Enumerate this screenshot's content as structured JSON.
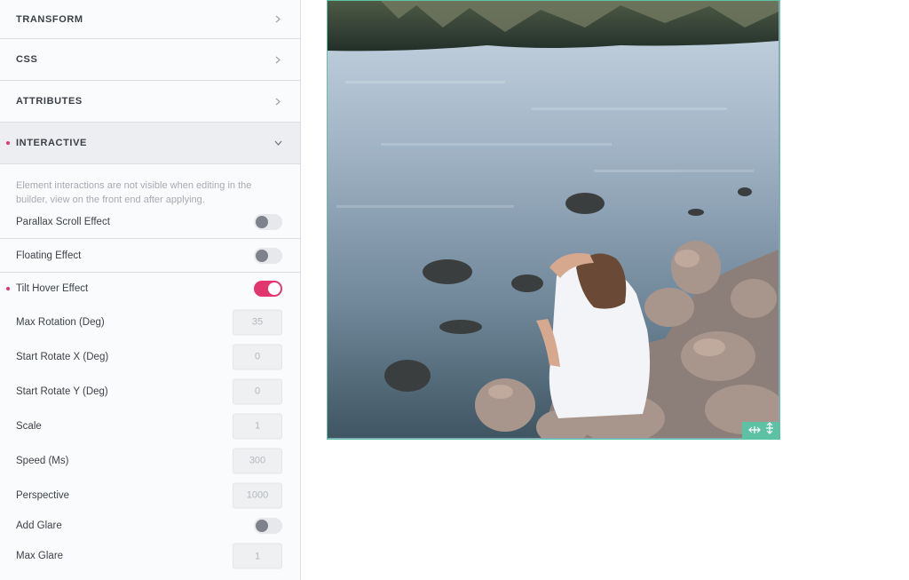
{
  "sidebar": {
    "sections": {
      "transform": "TRANSFORM",
      "css": "CSS",
      "attributes": "ATTRIBUTES",
      "interactive": "INTERACTIVE"
    },
    "interactive": {
      "description": "Element interactions are not visible when editing in the builder, view on the front end after applying.",
      "parallax": {
        "label": "Parallax Scroll Effect",
        "enabled": false
      },
      "floating": {
        "label": "Floating Effect",
        "enabled": false
      },
      "tilt": {
        "label": "Tilt Hover Effect",
        "enabled": true
      },
      "fields": {
        "max_rotation": {
          "label": "Max Rotation (Deg)",
          "placeholder": "35"
        },
        "start_x": {
          "label": "Start Rotate X (Deg)",
          "placeholder": "0"
        },
        "start_y": {
          "label": "Start Rotate Y (Deg)",
          "placeholder": "0"
        },
        "scale": {
          "label": "Scale",
          "placeholder": "1"
        },
        "speed": {
          "label": "Speed (Ms)",
          "placeholder": "300"
        },
        "perspective": {
          "label": "Perspective",
          "placeholder": "1000"
        }
      },
      "glare": {
        "label": "Add Glare",
        "enabled": false
      },
      "max_glare": {
        "label": "Max Glare",
        "placeholder": "1"
      }
    }
  },
  "colors": {
    "accent": "#e2366f",
    "selection": "#5cc2a3"
  },
  "icons": {
    "chevron": "chevron-right-icon",
    "chevron_open": "chevron-down-icon",
    "resize_h": "resize-horizontal-icon",
    "resize_v": "resize-vertical-icon"
  }
}
